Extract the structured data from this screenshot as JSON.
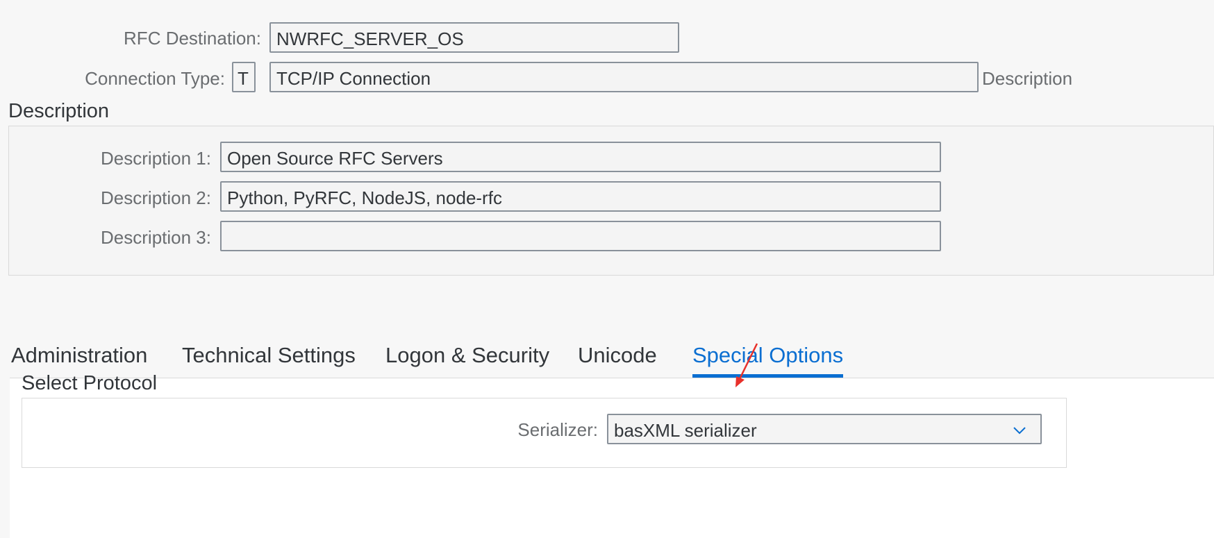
{
  "header": {
    "rfc_destination_label": "RFC Destination:",
    "rfc_destination_value": "NWRFC_SERVER_OS",
    "connection_type_label": "Connection Type:",
    "connection_type_code": "T",
    "connection_type_value": "TCP/IP Connection",
    "connection_type_trailing": "Description"
  },
  "description_group": {
    "title": "Description",
    "rows": [
      {
        "label": "Description 1:",
        "value": "Open Source RFC Servers"
      },
      {
        "label": "Description 2:",
        "value": "Python, PyRFC, NodeJS, node-rfc"
      },
      {
        "label": "Description 3:",
        "value": ""
      }
    ]
  },
  "tabs": [
    {
      "label": "Administration",
      "active": false
    },
    {
      "label": "Technical Settings",
      "active": false
    },
    {
      "label": "Logon & Security",
      "active": false
    },
    {
      "label": "Unicode",
      "active": false
    },
    {
      "label": "Special Options",
      "active": true
    }
  ],
  "select_protocol": {
    "title": "Select Protocol",
    "serializer_label": "Serializer:",
    "serializer_value": "basXML serializer",
    "dropdown_icon": "chevron-down-icon"
  },
  "colors": {
    "accent": "#0a6ed1",
    "annotation_arrow": "#e8302a",
    "background": "#f7f7f7",
    "field_border": "#89919a"
  }
}
